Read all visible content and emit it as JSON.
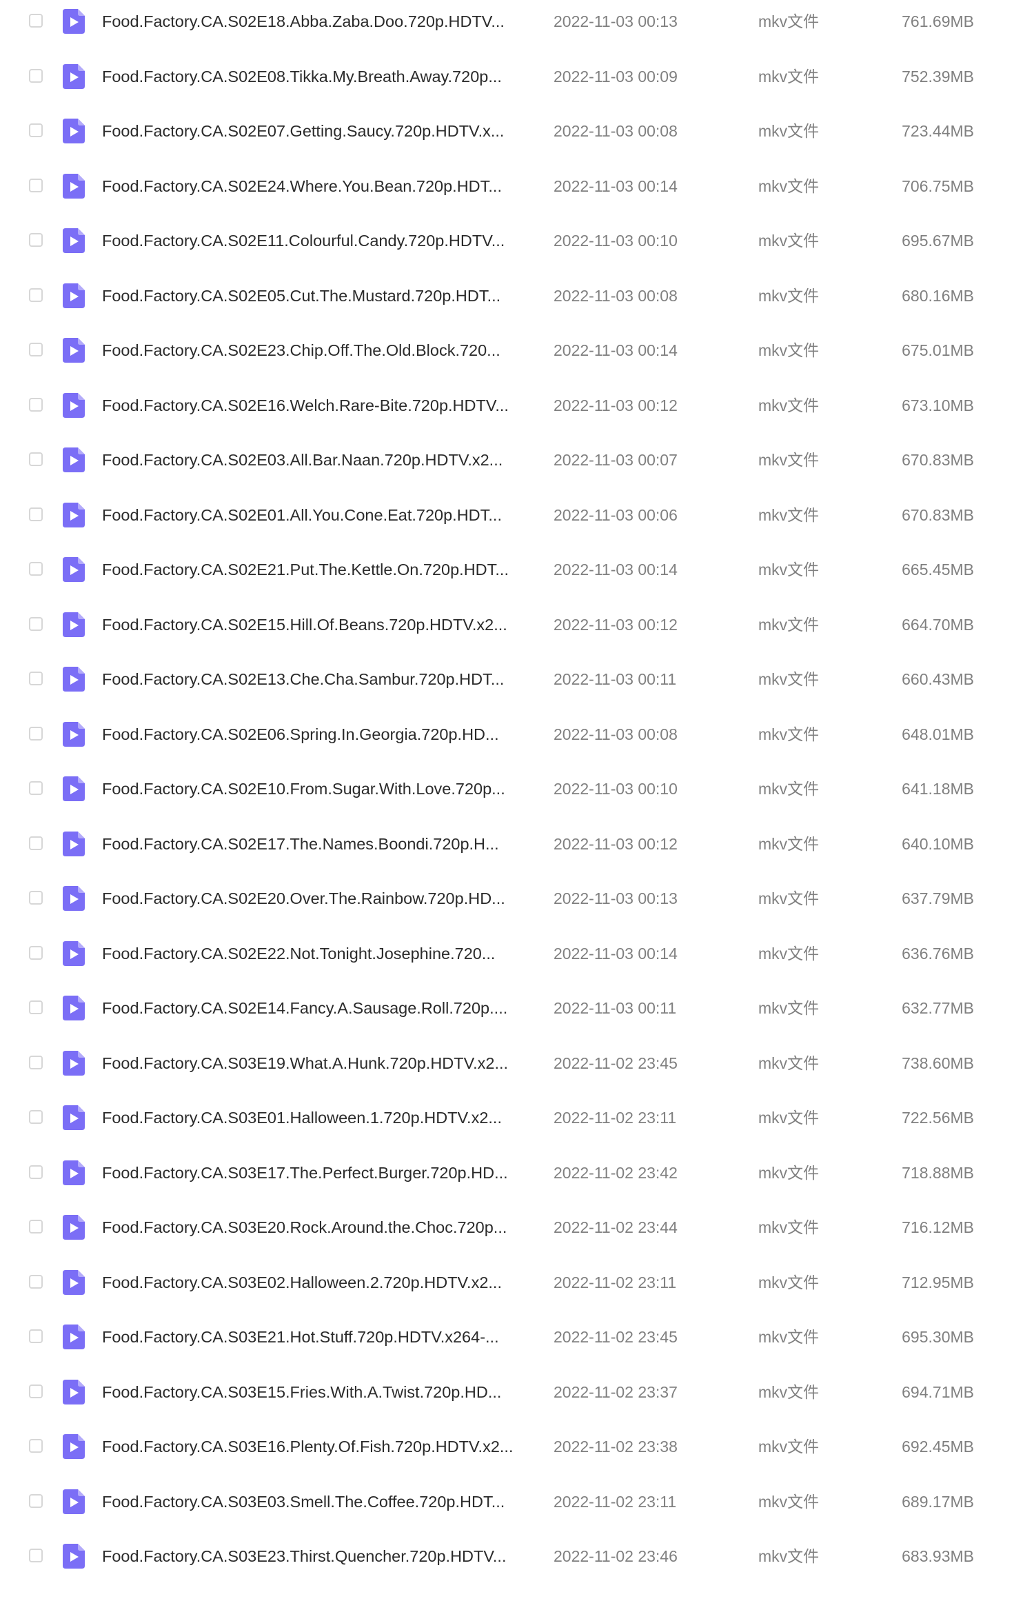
{
  "file_list": {
    "rows": [
      {
        "name": "Food.Factory.CA.S02E18.Abba.Zaba.Doo.720p.HDTV...",
        "date": "2022-11-03 00:13",
        "type": "mkv文件",
        "size": "761.69MB"
      },
      {
        "name": "Food.Factory.CA.S02E08.Tikka.My.Breath.Away.720p...",
        "date": "2022-11-03 00:09",
        "type": "mkv文件",
        "size": "752.39MB"
      },
      {
        "name": "Food.Factory.CA.S02E07.Getting.Saucy.720p.HDTV.x...",
        "date": "2022-11-03 00:08",
        "type": "mkv文件",
        "size": "723.44MB"
      },
      {
        "name": "Food.Factory.CA.S02E24.Where.You.Bean.720p.HDT...",
        "date": "2022-11-03 00:14",
        "type": "mkv文件",
        "size": "706.75MB"
      },
      {
        "name": "Food.Factory.CA.S02E11.Colourful.Candy.720p.HDTV...",
        "date": "2022-11-03 00:10",
        "type": "mkv文件",
        "size": "695.67MB"
      },
      {
        "name": "Food.Factory.CA.S02E05.Cut.The.Mustard.720p.HDT...",
        "date": "2022-11-03 00:08",
        "type": "mkv文件",
        "size": "680.16MB"
      },
      {
        "name": "Food.Factory.CA.S02E23.Chip.Off.The.Old.Block.720...",
        "date": "2022-11-03 00:14",
        "type": "mkv文件",
        "size": "675.01MB"
      },
      {
        "name": "Food.Factory.CA.S02E16.Welch.Rare-Bite.720p.HDTV...",
        "date": "2022-11-03 00:12",
        "type": "mkv文件",
        "size": "673.10MB"
      },
      {
        "name": "Food.Factory.CA.S02E03.All.Bar.Naan.720p.HDTV.x2...",
        "date": "2022-11-03 00:07",
        "type": "mkv文件",
        "size": "670.83MB"
      },
      {
        "name": "Food.Factory.CA.S02E01.All.You.Cone.Eat.720p.HDT...",
        "date": "2022-11-03 00:06",
        "type": "mkv文件",
        "size": "670.83MB"
      },
      {
        "name": "Food.Factory.CA.S02E21.Put.The.Kettle.On.720p.HDT...",
        "date": "2022-11-03 00:14",
        "type": "mkv文件",
        "size": "665.45MB"
      },
      {
        "name": "Food.Factory.CA.S02E15.Hill.Of.Beans.720p.HDTV.x2...",
        "date": "2022-11-03 00:12",
        "type": "mkv文件",
        "size": "664.70MB"
      },
      {
        "name": "Food.Factory.CA.S02E13.Che.Cha.Sambur.720p.HDT...",
        "date": "2022-11-03 00:11",
        "type": "mkv文件",
        "size": "660.43MB"
      },
      {
        "name": "Food.Factory.CA.S02E06.Spring.In.Georgia.720p.HD...",
        "date": "2022-11-03 00:08",
        "type": "mkv文件",
        "size": "648.01MB"
      },
      {
        "name": "Food.Factory.CA.S02E10.From.Sugar.With.Love.720p...",
        "date": "2022-11-03 00:10",
        "type": "mkv文件",
        "size": "641.18MB"
      },
      {
        "name": "Food.Factory.CA.S02E17.The.Names.Boondi.720p.H...",
        "date": "2022-11-03 00:12",
        "type": "mkv文件",
        "size": "640.10MB"
      },
      {
        "name": "Food.Factory.CA.S02E20.Over.The.Rainbow.720p.HD...",
        "date": "2022-11-03 00:13",
        "type": "mkv文件",
        "size": "637.79MB"
      },
      {
        "name": "Food.Factory.CA.S02E22.Not.Tonight.Josephine.720...",
        "date": "2022-11-03 00:14",
        "type": "mkv文件",
        "size": "636.76MB"
      },
      {
        "name": "Food.Factory.CA.S02E14.Fancy.A.Sausage.Roll.720p....",
        "date": "2022-11-03 00:11",
        "type": "mkv文件",
        "size": "632.77MB"
      },
      {
        "name": "Food.Factory.CA.S03E19.What.A.Hunk.720p.HDTV.x2...",
        "date": "2022-11-02 23:45",
        "type": "mkv文件",
        "size": "738.60MB"
      },
      {
        "name": "Food.Factory.CA.S03E01.Halloween.1.720p.HDTV.x2...",
        "date": "2022-11-02 23:11",
        "type": "mkv文件",
        "size": "722.56MB"
      },
      {
        "name": "Food.Factory.CA.S03E17.The.Perfect.Burger.720p.HD...",
        "date": "2022-11-02 23:42",
        "type": "mkv文件",
        "size": "718.88MB"
      },
      {
        "name": "Food.Factory.CA.S03E20.Rock.Around.the.Choc.720p...",
        "date": "2022-11-02 23:44",
        "type": "mkv文件",
        "size": "716.12MB"
      },
      {
        "name": "Food.Factory.CA.S03E02.Halloween.2.720p.HDTV.x2...",
        "date": "2022-11-02 23:11",
        "type": "mkv文件",
        "size": "712.95MB"
      },
      {
        "name": "Food.Factory.CA.S03E21.Hot.Stuff.720p.HDTV.x264-...",
        "date": "2022-11-02 23:45",
        "type": "mkv文件",
        "size": "695.30MB"
      },
      {
        "name": "Food.Factory.CA.S03E15.Fries.With.A.Twist.720p.HD...",
        "date": "2022-11-02 23:37",
        "type": "mkv文件",
        "size": "694.71MB"
      },
      {
        "name": "Food.Factory.CA.S03E16.Plenty.Of.Fish.720p.HDTV.x2...",
        "date": "2022-11-02 23:38",
        "type": "mkv文件",
        "size": "692.45MB"
      },
      {
        "name": "Food.Factory.CA.S03E03.Smell.The.Coffee.720p.HDT...",
        "date": "2022-11-02 23:11",
        "type": "mkv文件",
        "size": "689.17MB"
      },
      {
        "name": "Food.Factory.CA.S03E23.Thirst.Quencher.720p.HDTV...",
        "date": "2022-11-02 23:46",
        "type": "mkv文件",
        "size": "683.93MB"
      }
    ]
  },
  "icons": {
    "file_icon": "video-file-icon",
    "checkbox": "checkbox-unchecked"
  },
  "colors": {
    "file_icon_fill": "#7b6ef6",
    "file_icon_fold": "#b4abfa",
    "name_text": "#2b2b2b",
    "meta_text": "#808080",
    "checkbox_border": "#d7d7d7",
    "background": "#ffffff"
  }
}
